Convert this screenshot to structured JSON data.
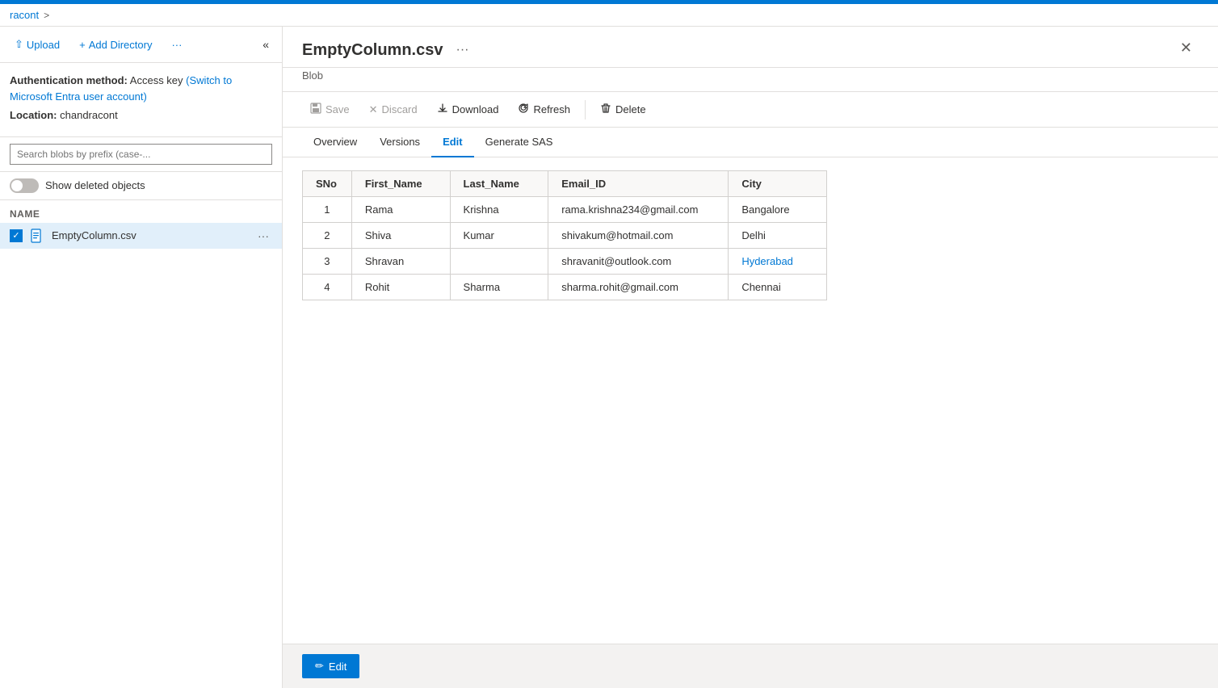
{
  "topbar": {
    "color": "#0078d4"
  },
  "breadcrumb": {
    "items": [
      {
        "label": "racont",
        "separator": ">"
      }
    ]
  },
  "sidebar": {
    "collapse_icon": "«",
    "toolbar": {
      "upload_label": "Upload",
      "add_directory_label": "Add Directory",
      "more_label": "···"
    },
    "auth": {
      "prefix": "Authentication method:",
      "method": "Access key",
      "switch_link": "Switch to Microsoft Entra user account)",
      "location_label": "Location:",
      "location_value": "chandracont"
    },
    "search_placeholder": "Search blobs by prefix (case-...",
    "toggle_label": "Show deleted objects",
    "files_header": "Name",
    "files": [
      {
        "name": "EmptyColumn.csv",
        "selected": true
      }
    ]
  },
  "detail": {
    "title": "EmptyColumn.csv",
    "ellipsis": "···",
    "subtitle": "Blob",
    "close_icon": "✕",
    "toolbar": {
      "save_label": "Save",
      "discard_label": "Discard",
      "download_label": "Download",
      "refresh_label": "Refresh",
      "delete_label": "Delete"
    },
    "tabs": [
      {
        "label": "Overview",
        "active": false
      },
      {
        "label": "Versions",
        "active": false
      },
      {
        "label": "Edit",
        "active": true
      },
      {
        "label": "Generate SAS",
        "active": false
      }
    ],
    "table": {
      "columns": [
        "SNo",
        "First_Name",
        "Last_Name",
        "Email_ID",
        "City"
      ],
      "rows": [
        {
          "sno": "1",
          "first_name": "Rama",
          "last_name": "Krishna",
          "email": "rama.krishna234@gmail.com",
          "city": "Bangalore",
          "city_blue": false
        },
        {
          "sno": "2",
          "first_name": "Shiva",
          "last_name": "Kumar",
          "email": "shivakum@hotmail.com",
          "city": "Delhi",
          "city_blue": false
        },
        {
          "sno": "3",
          "first_name": "Shravan",
          "last_name": "",
          "email": "shravanit@outlook.com",
          "city": "Hyderabad",
          "city_blue": true
        },
        {
          "sno": "4",
          "first_name": "Rohit",
          "last_name": "Sharma",
          "email": "sharma.rohit@gmail.com",
          "city": "Chennai",
          "city_blue": false
        }
      ]
    },
    "edit_button_label": "Edit"
  }
}
